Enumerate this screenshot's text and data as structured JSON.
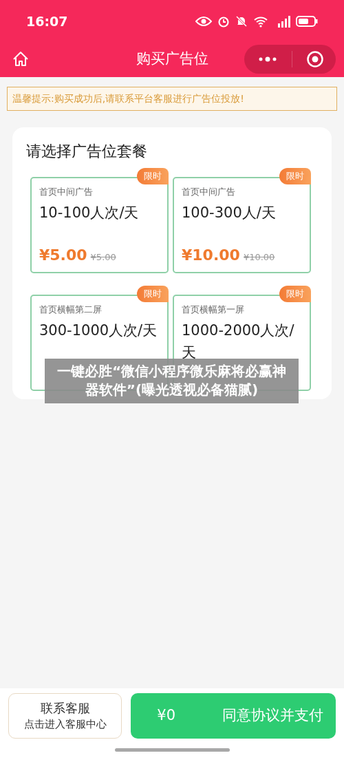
{
  "status_bar": {
    "time": "16:07"
  },
  "nav": {
    "title": "购买广告位"
  },
  "notice": "温馨提示:购买成功后,请联系平台客服进行广告位投放!",
  "section_title": "请选择广告位套餐",
  "packages": [
    {
      "badge": "限时",
      "category": "首页中间广告",
      "name": "10-100人次/天",
      "price": "¥5.00",
      "old_price": "¥5.00"
    },
    {
      "badge": "限时",
      "category": "首页中间广告",
      "name": "100-300人/天",
      "price": "¥10.00",
      "old_price": "¥10.00"
    },
    {
      "badge": "限时",
      "category": "首页横幅第二屏",
      "name": "300-1000人次/天"
    },
    {
      "badge": "限时",
      "category": "首页横幅第一屏",
      "name": "1000-2000人次/天"
    }
  ],
  "overlay_caption": "一键必胜“微信小程序微乐麻将必赢神器软件”(曝光透视必备猫腻)",
  "bottom_bar": {
    "contact_title": "联系客服",
    "contact_subtitle": "点击进入客服中心",
    "total": "¥0",
    "pay_label": "同意协议并支付"
  }
}
